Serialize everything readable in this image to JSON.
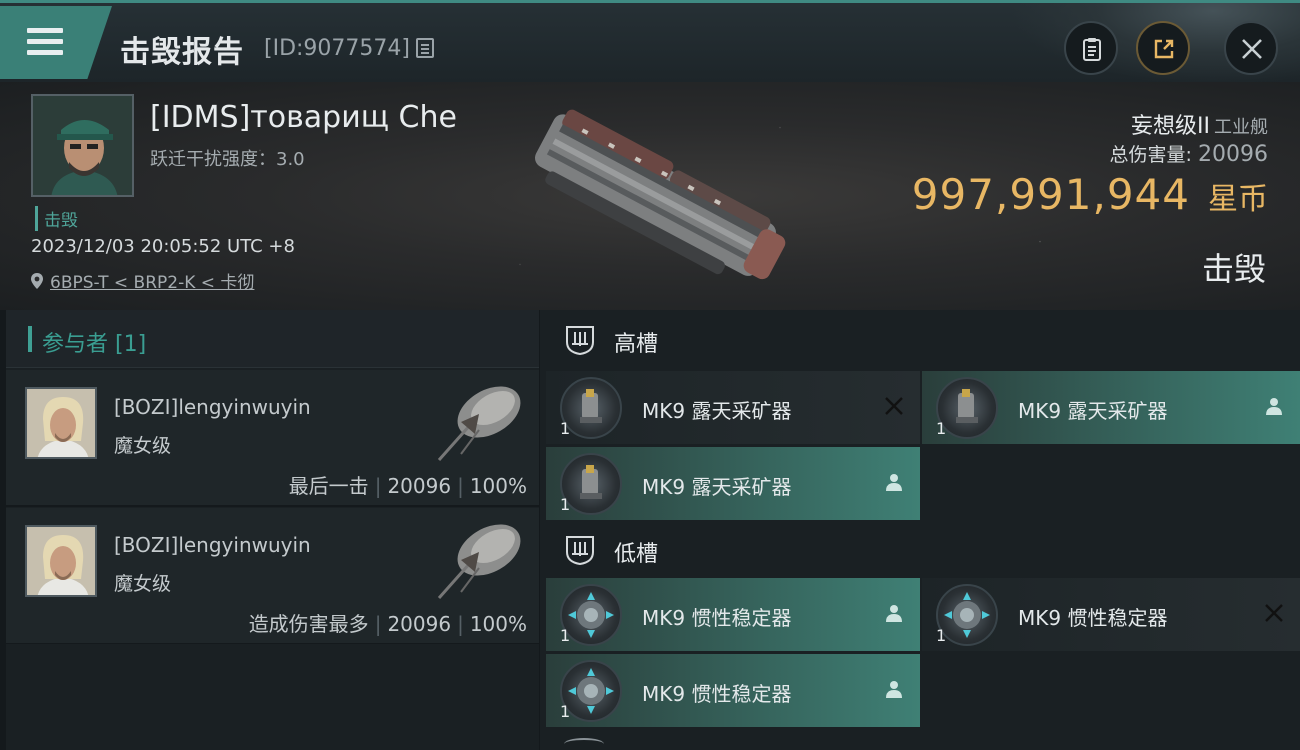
{
  "topbar": {
    "title": "击毁报告",
    "id_text": "[ID:9077574]"
  },
  "victim": {
    "name": "[IDMS]товарищ Che",
    "warp_label": "跃迁干扰强度：3.0",
    "status": "击毁",
    "datetime": "2023/12/03 20:05:52 UTC +8",
    "location": "6BPS-T < BRP2-K < 卡彻",
    "ship_class": "妄想级II",
    "ship_type": "工业舰",
    "total_damage_label": "总伤害量:",
    "total_damage": "20096",
    "isk_value": "997,991,944",
    "isk_unit": "星币",
    "result": "击毁"
  },
  "participants": {
    "header": "参与者 [1]",
    "items": [
      {
        "name": "[BOZI]lengyinwuyin",
        "ship": "魔女级",
        "tag": "最后一击",
        "damage": "20096",
        "percent": "100%"
      },
      {
        "name": "[BOZI]lengyinwuyin",
        "ship": "魔女级",
        "tag": "造成伤害最多",
        "damage": "20096",
        "percent": "100%"
      }
    ]
  },
  "high_slots": {
    "label": "高槽",
    "modules": [
      {
        "name": "MK9 露天采矿器",
        "qty": "1",
        "state": "destroyed",
        "icon": "close-icon"
      },
      {
        "name": "MK9 露天采矿器",
        "qty": "1",
        "state": "dropped",
        "icon": "person-icon"
      },
      {
        "name": "MK9 露天采矿器",
        "qty": "1",
        "state": "dropped",
        "icon": "person-icon"
      }
    ]
  },
  "low_slots": {
    "label": "低槽",
    "modules": [
      {
        "name": "MK9 惯性稳定器",
        "qty": "1",
        "state": "dropped",
        "icon": "person-icon"
      },
      {
        "name": "MK9 惯性稳定器",
        "qty": "1",
        "state": "destroyed",
        "icon": "close-icon"
      },
      {
        "name": "MK9 惯性稳定器",
        "qty": "1",
        "state": "dropped",
        "icon": "person-icon"
      }
    ]
  },
  "colors": {
    "accent": "#3f8a82",
    "isk": "#e8b764",
    "dropped_bg": "#3f8075"
  }
}
